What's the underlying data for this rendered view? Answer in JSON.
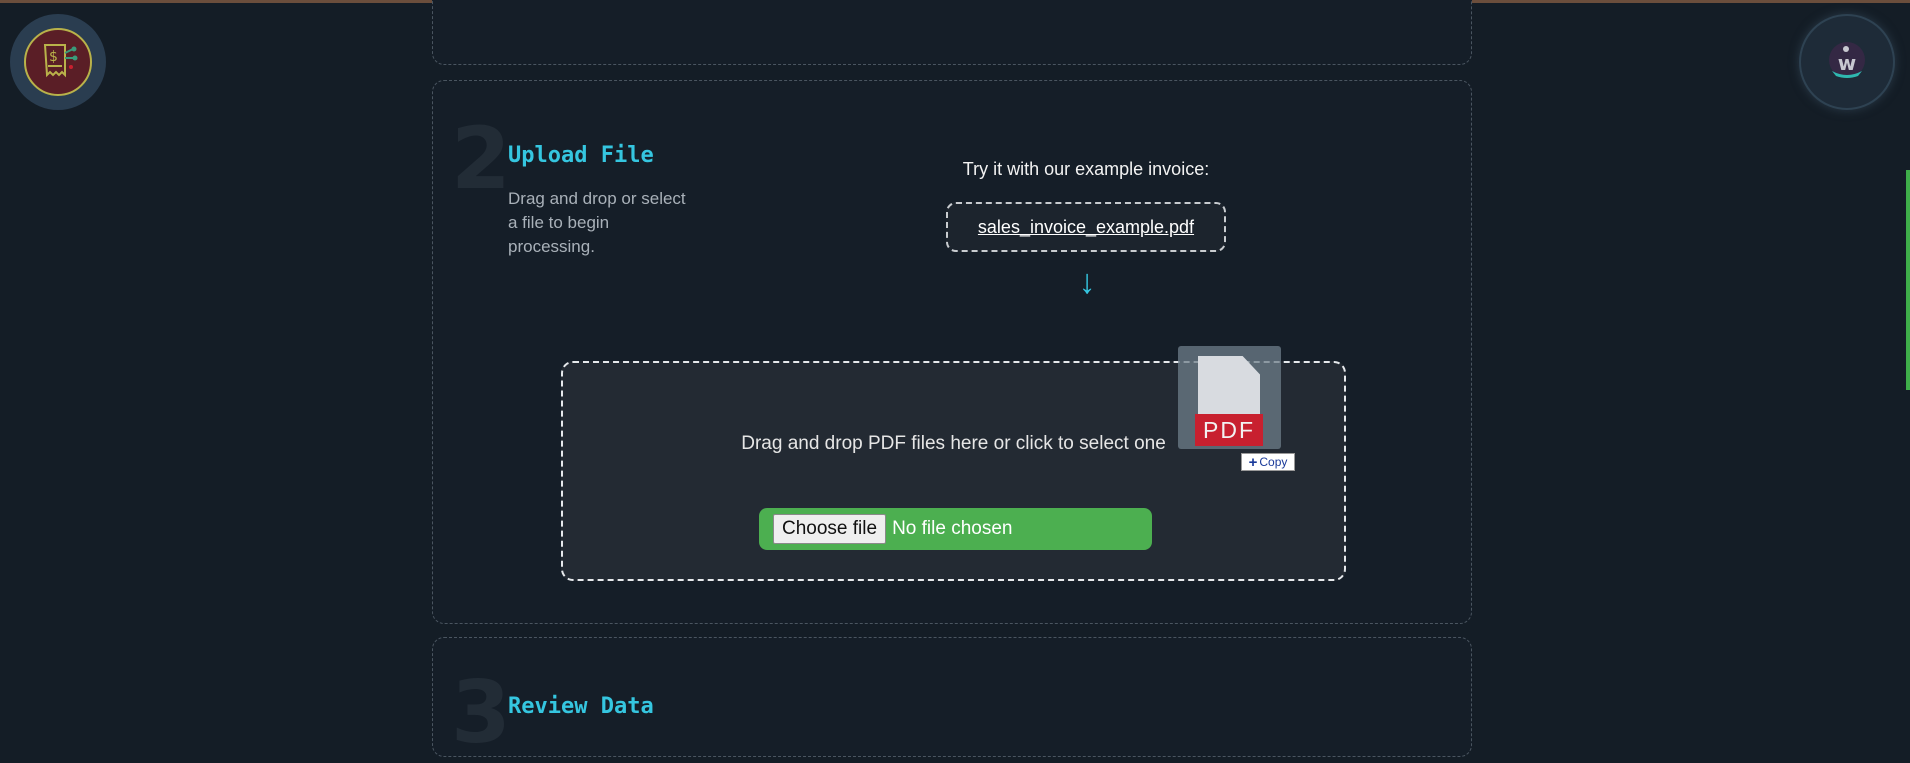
{
  "logos": {
    "left": "receipt-dollar-logo",
    "right": "w-splash-logo",
    "right_letter": "w"
  },
  "step2": {
    "number": "2",
    "title": "Upload File",
    "description": "Drag and drop or select a file to begin processing.",
    "try_label": "Try it with our example invoice:",
    "example_file": "sales_invoice_example.pdf",
    "arrow": "↓",
    "dropzone_text": "Drag and drop PDF files here or click to select one",
    "choose_file_label": "Choose file",
    "no_file_text": "No file chosen"
  },
  "drag_ghost": {
    "file_label": "PDF",
    "copy_label": "Copy",
    "copy_icon": "+"
  },
  "step3": {
    "number": "3",
    "title": "Review Data"
  },
  "colors": {
    "accent": "#35c6e0",
    "file_input_bg": "#4caf50",
    "pdf_red": "#c8202f"
  }
}
